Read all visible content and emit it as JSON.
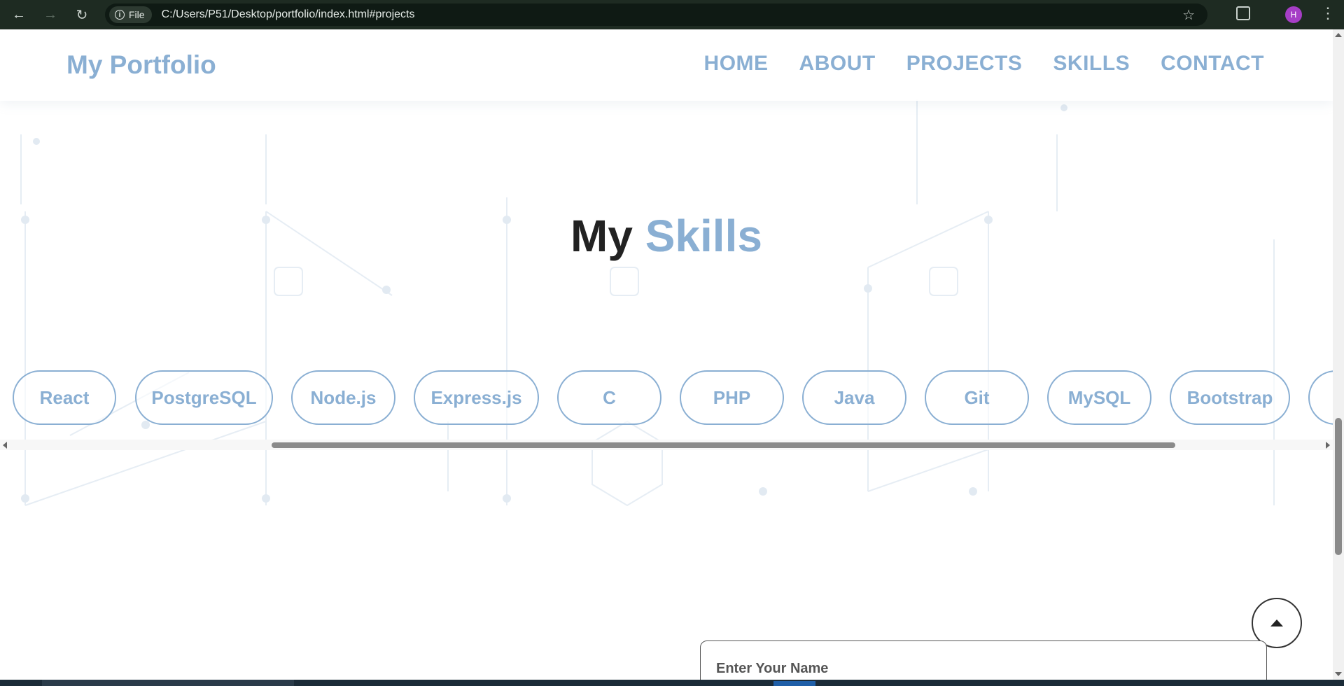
{
  "browser": {
    "chip_label": "File",
    "url": "C:/Users/P51/Desktop/portfolio/index.html#projects",
    "avatar_initial": "H"
  },
  "header": {
    "logo": "My Portfolio",
    "nav": [
      "HOME",
      "ABOUT",
      "PROJECTS",
      "SKILLS",
      "CONTACT"
    ]
  },
  "skills_section": {
    "title_plain": "My",
    "title_accent": "Skills",
    "skills": [
      "React",
      "PostgreSQL",
      "Node.js",
      "Express.js",
      "C",
      "PHP",
      "Java",
      "Git",
      "MySQL",
      "Bootstrap"
    ]
  },
  "contact": {
    "name_placeholder": "Enter Your Name"
  },
  "colors": {
    "accent": "#8aafd3",
    "heading": "#222222",
    "chrome": "#1e2b22"
  }
}
